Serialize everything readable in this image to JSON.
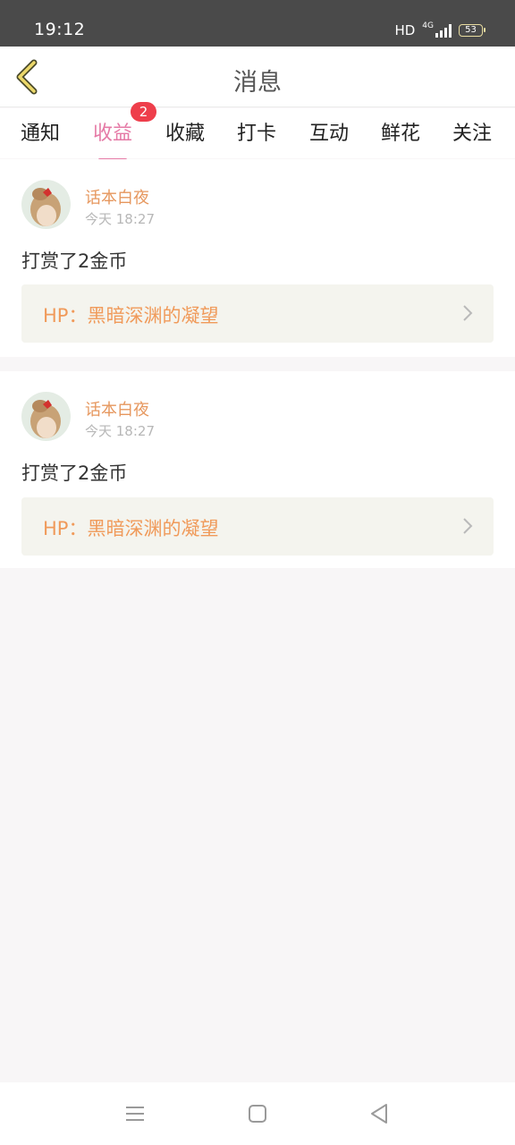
{
  "status_bar": {
    "time": "19:12",
    "hd": "HD",
    "network": "4G",
    "battery": "53"
  },
  "header": {
    "title": "消息",
    "back_icon": "chevron-left-icon"
  },
  "tabs": [
    {
      "label": "通知",
      "active": false
    },
    {
      "label": "收益",
      "active": true,
      "badge": "2"
    },
    {
      "label": "收藏",
      "active": false
    },
    {
      "label": "打卡",
      "active": false
    },
    {
      "label": "互动",
      "active": false
    },
    {
      "label": "鲜花",
      "active": false
    },
    {
      "label": "关注",
      "active": false
    }
  ],
  "messages": [
    {
      "username": "话本白夜",
      "time": "今天 18:27",
      "content": "打赏了2金币",
      "target": "HP：黑暗深渊的凝望"
    },
    {
      "username": "话本白夜",
      "time": "今天 18:27",
      "content": "打赏了2金币",
      "target": "HP：黑暗深渊的凝望"
    }
  ],
  "nav": {
    "menu_icon": "menu-icon",
    "home_icon": "home-square-icon",
    "back_icon": "back-triangle-icon"
  },
  "colors": {
    "accent": "#e57aa6",
    "badge": "#ee3e4b",
    "username": "#e6975e",
    "target_text": "#f09a5a",
    "target_bg": "#f4f4ee"
  }
}
